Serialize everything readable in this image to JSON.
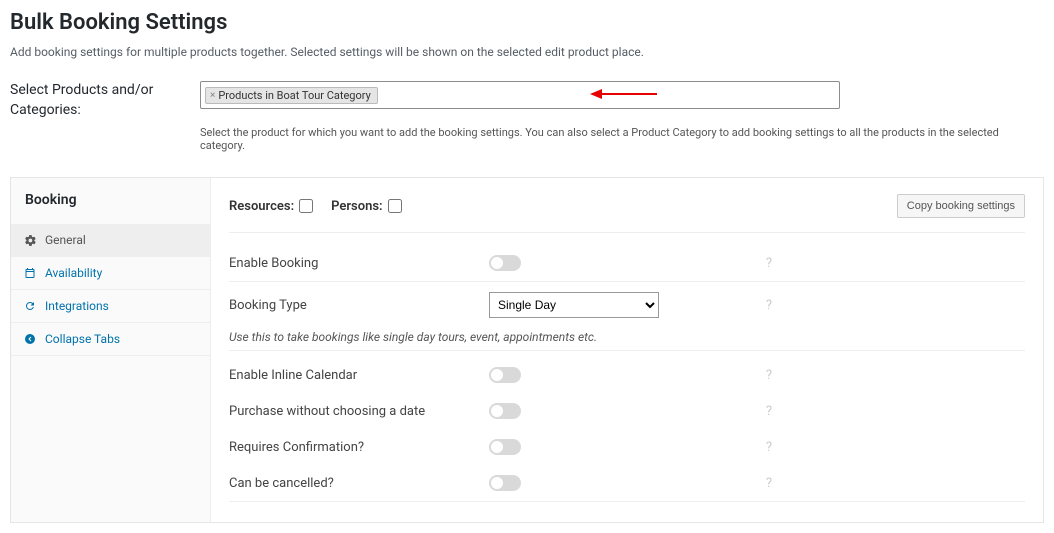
{
  "page": {
    "title": "Bulk Booking Settings",
    "subtitle": "Add booking settings for multiple products together. Selected settings will be shown on the selected edit product place."
  },
  "selectProducts": {
    "label": "Select Products and/or Categories:",
    "chipText": "Products in Boat Tour Category",
    "chipX": "×",
    "help": "Select the product for which you want to add the booking settings. You can also select a Product Category to add booking settings to all the products in the selected category."
  },
  "sidebar": {
    "title": "Booking",
    "items": [
      {
        "label": "General"
      },
      {
        "label": "Availability"
      },
      {
        "label": "Integrations"
      },
      {
        "label": "Collapse Tabs"
      }
    ]
  },
  "toprow": {
    "resourcesLabel": "Resources:",
    "personsLabel": "Persons:",
    "copyButton": "Copy booking settings"
  },
  "fields": {
    "enableBooking": "Enable Booking",
    "bookingType": "Booking Type",
    "bookingTypeValue": "Single Day",
    "bookingTypeHint": "Use this to take bookings like single day tours, event, appointments etc.",
    "enableInline": "Enable Inline Calendar",
    "purchaseWithout": "Purchase without choosing a date",
    "requiresConfirmation": "Requires Confirmation?",
    "canBeCancelled": "Can be cancelled?"
  },
  "icons": {
    "help": "?"
  }
}
